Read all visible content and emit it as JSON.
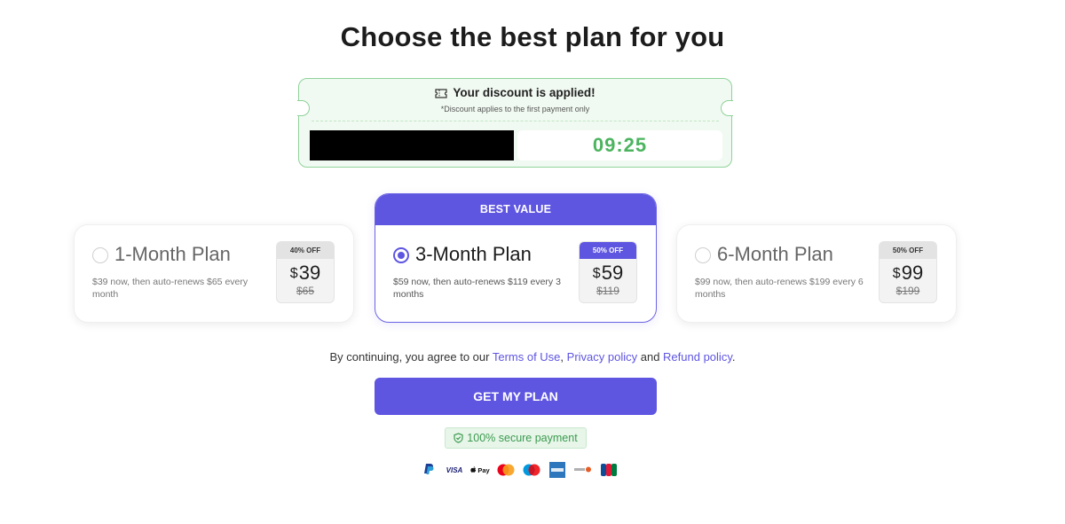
{
  "page": {
    "title": "Choose the best plan for you"
  },
  "discount": {
    "headline": "Your discount is applied!",
    "note": "*Discount applies to the first payment only",
    "timer": "09:25"
  },
  "plans": [
    {
      "name": "1-Month Plan",
      "desc": "$39 now, then auto-renews $65 every month",
      "off": "40% OFF",
      "currency": "$",
      "price": "39",
      "old_price": "$65",
      "selected": false
    },
    {
      "name": "3-Month Plan",
      "desc": "$59 now, then auto-renews $119 every 3 months",
      "off": "50% OFF",
      "currency": "$",
      "price": "59",
      "old_price": "$119",
      "selected": true,
      "banner": "BEST VALUE"
    },
    {
      "name": "6-Month Plan",
      "desc": "$99 now, then auto-renews $199 every 6 months",
      "off": "50% OFF",
      "currency": "$",
      "price": "99",
      "old_price": "$199",
      "selected": false
    }
  ],
  "agreement": {
    "prefix": "By continuing, you agree to our ",
    "terms": "Terms of Use",
    "comma": ", ",
    "privacy": "Privacy policy",
    "and": " and ",
    "refund": "Refund policy",
    "suffix": "."
  },
  "cta": {
    "label": "GET MY PLAN"
  },
  "secure": {
    "label": "100% secure payment"
  },
  "payment_methods": [
    {
      "icon": "paypal-icon",
      "color": "#1c3f95"
    },
    {
      "icon": "visa-icon",
      "label": "VISA",
      "color": "#1a1f71"
    },
    {
      "icon": "apple-pay-icon",
      "label": "Pay",
      "color": "#111111"
    },
    {
      "icon": "mastercard-icon",
      "color": "#eb001b"
    },
    {
      "icon": "maestro-icon",
      "color": "#0099df"
    },
    {
      "icon": "amex-icon",
      "color": "#2e77bc"
    },
    {
      "icon": "discover-icon",
      "color": "#e65c25"
    },
    {
      "icon": "jcb-icon",
      "label": "JCB",
      "color": "#0e4c96"
    }
  ],
  "colors": {
    "accent": "#5e55e1",
    "success": "#4cb45f"
  }
}
